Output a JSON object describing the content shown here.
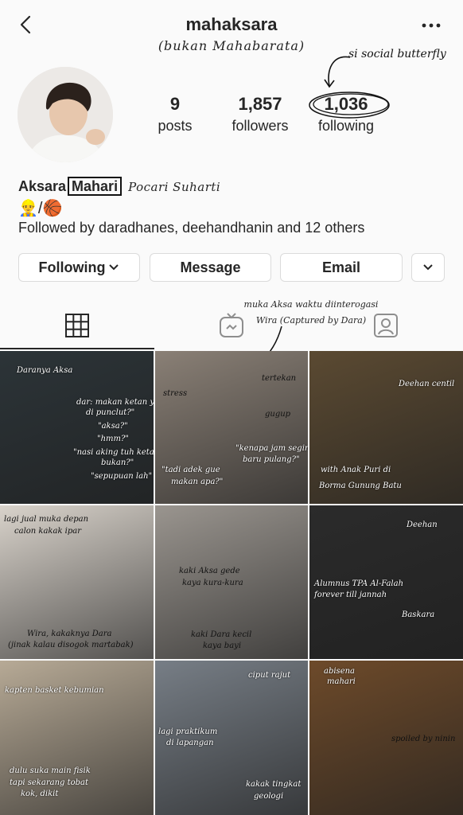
{
  "header": {
    "username": "mahaksara",
    "subtitle": "(bukan Mahabarata)",
    "note_butterfly": "si social butterfly"
  },
  "stats": {
    "posts_count": "9",
    "posts_label": "posts",
    "followers_count": "1,857",
    "followers_label": "followers",
    "following_count": "1,036",
    "following_label": "following"
  },
  "bio": {
    "name_first": "Aksara",
    "name_boxed": "Mahari",
    "name_extra": "Pocari Suharti",
    "emoji_line": "👷‍♂️/🏀",
    "followed_by": "Followed by daradhanes, deehandhanin and 12 others"
  },
  "actions": {
    "following_label": "Following",
    "message_label": "Message",
    "email_label": "Email"
  },
  "tabs": {
    "note_line1": "muka Aksa waktu diinterogasi",
    "note_line2": "Wira (Captured by Dara)"
  },
  "posts": [
    {
      "captions": [
        "Daranya Aksa",
        "dar: makan ketan yuk",
        "di punclut?\"",
        "\"aksa?\"",
        "\"hmm?\"",
        "\"nasi aking tuh ketan",
        "bukan?\"",
        "\"sepupuan lah\""
      ],
      "bg": "#2c3438"
    },
    {
      "captions": [
        "stress",
        "tertekan",
        "gugup",
        "\"kenapa jam segini",
        "baru pulang?\"",
        "\"tadi adek gue",
        "makan apa?\""
      ],
      "bg": "#8a8076"
    },
    {
      "captions": [
        "Deehan centil",
        "with Anak Puri di",
        "Borma Gunung Batu"
      ],
      "bg": "#5b4a32"
    },
    {
      "captions": [
        "lagi jual muka depan",
        "calon kakak ipar",
        "Wira, kakaknya Dara",
        "(jinak kalau disogok martabak)"
      ],
      "bg": "#d9d3cb"
    },
    {
      "captions": [
        "kaki Aksa gede",
        "kaya kura-kura",
        "kaki Dara kecil",
        "kaya bayi"
      ],
      "bg": "#9a958f"
    },
    {
      "captions": [
        "Deehan",
        "Alumnus TPA Al-Falah",
        "forever till jannah",
        "Baskara"
      ],
      "bg": "#2b2b2b"
    },
    {
      "captions": [
        "kapten basket kebumian",
        "dulu suka main fisik",
        "tapi sekarang tobat",
        "kok, dikit"
      ],
      "bg": "#b7aa96"
    },
    {
      "captions": [
        "ciput rajut",
        "lagi praktikum",
        "di lapangan",
        "kakak tingkat",
        "geologi"
      ],
      "bg": "#777e86"
    },
    {
      "captions": [
        "abisena",
        "mahari",
        "spoiled by ninin"
      ],
      "bg": "#6d4a2a"
    }
  ]
}
